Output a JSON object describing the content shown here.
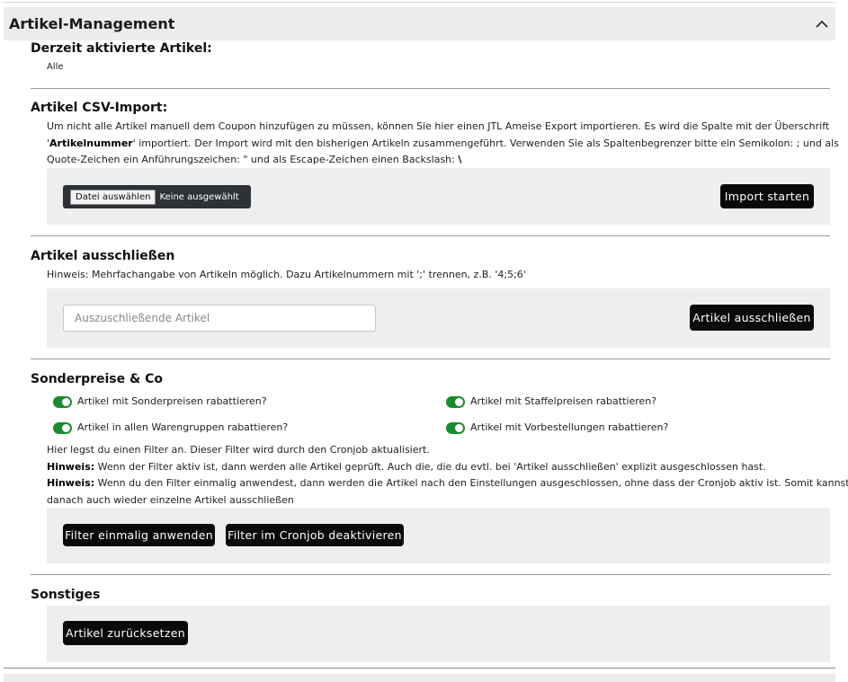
{
  "header": {
    "title": "Artikel-Management",
    "collapse_icon": "chevron-up-icon"
  },
  "active": {
    "title": "Derzeit aktivierte Artikel:",
    "value": "Alle"
  },
  "csv": {
    "title": "Artikel CSV-Import:",
    "line1": "Um nicht alle Artikel manuell dem Coupon hinzufügen zu müssen, können Sie hier einen JTL Ameise Export importieren. Es wird die Spalte mit der Überschrift",
    "line2_pre": "'",
    "line2_bold": "Artikelnummer",
    "line2_post": "' importiert. Der Import wird mit den bisherigen Artikeln zusammengeführt. Verwenden Sie als Spaltenbegrenzer bitte ein Semikolon: ; und als",
    "line3_pre": "Quote-Zeichen ein Anführungszeichen: \" und als Escape-Zeichen einen Backslash: ",
    "line3_bold": "\\",
    "file_button": "Datei auswählen",
    "file_status": "Keine ausgewählt",
    "import_button": "Import starten"
  },
  "exclude": {
    "title": "Artikel ausschließen",
    "hint": "Hinweis: Mehrfachangabe von Artikeln möglich. Dazu Artikelnummern mit ';' trennen, z.B. '4;5;6'",
    "placeholder": "Auszuschließende Artikel",
    "button": "Artikel ausschließen"
  },
  "special": {
    "title": "Sonderpreise & Co",
    "toggles": [
      {
        "label": "Artikel mit Sonderpreisen rabattieren?",
        "on": true
      },
      {
        "label": "Artikel mit Staffelpreisen rabattieren?",
        "on": true
      },
      {
        "label": "Artikel in allen Warengruppen rabattieren?",
        "on": true
      },
      {
        "label": "Artikel mit Vorbestellungen rabattieren?",
        "on": true
      }
    ],
    "info1": "Hier legst du einen Filter an. Dieser Filter wird durch den Cronjob aktualisiert.",
    "hint2_label": "Hinweis:",
    "hint2_text": " Wenn der Filter aktiv ist, dann werden alle Artikel geprüft. Auch die, die du evtl. bei 'Artikel ausschließen' explizit ausgeschlossen hast.",
    "hint3_label": "Hinweis:",
    "hint3_text": " Wenn du den Filter einmalig anwendest, dann werden die Artikel nach den Einstellungen ausgeschlossen, ohne dass der Cronjob aktiv ist. Somit kannst du",
    "hint3_line2": "danach auch wieder einzelne Artikel ausschließen",
    "apply_button": "Filter einmalig anwenden",
    "deactivate_button": "Filter im Cronjob deaktivieren"
  },
  "other": {
    "title": "Sonstiges",
    "reset_button": "Artikel zurücksetzen"
  },
  "colors": {
    "toggle_on": "#1c8a2f",
    "button_bg": "#0a0a0a",
    "box_bg": "#eeeeee",
    "header_bg": "#ececec"
  }
}
